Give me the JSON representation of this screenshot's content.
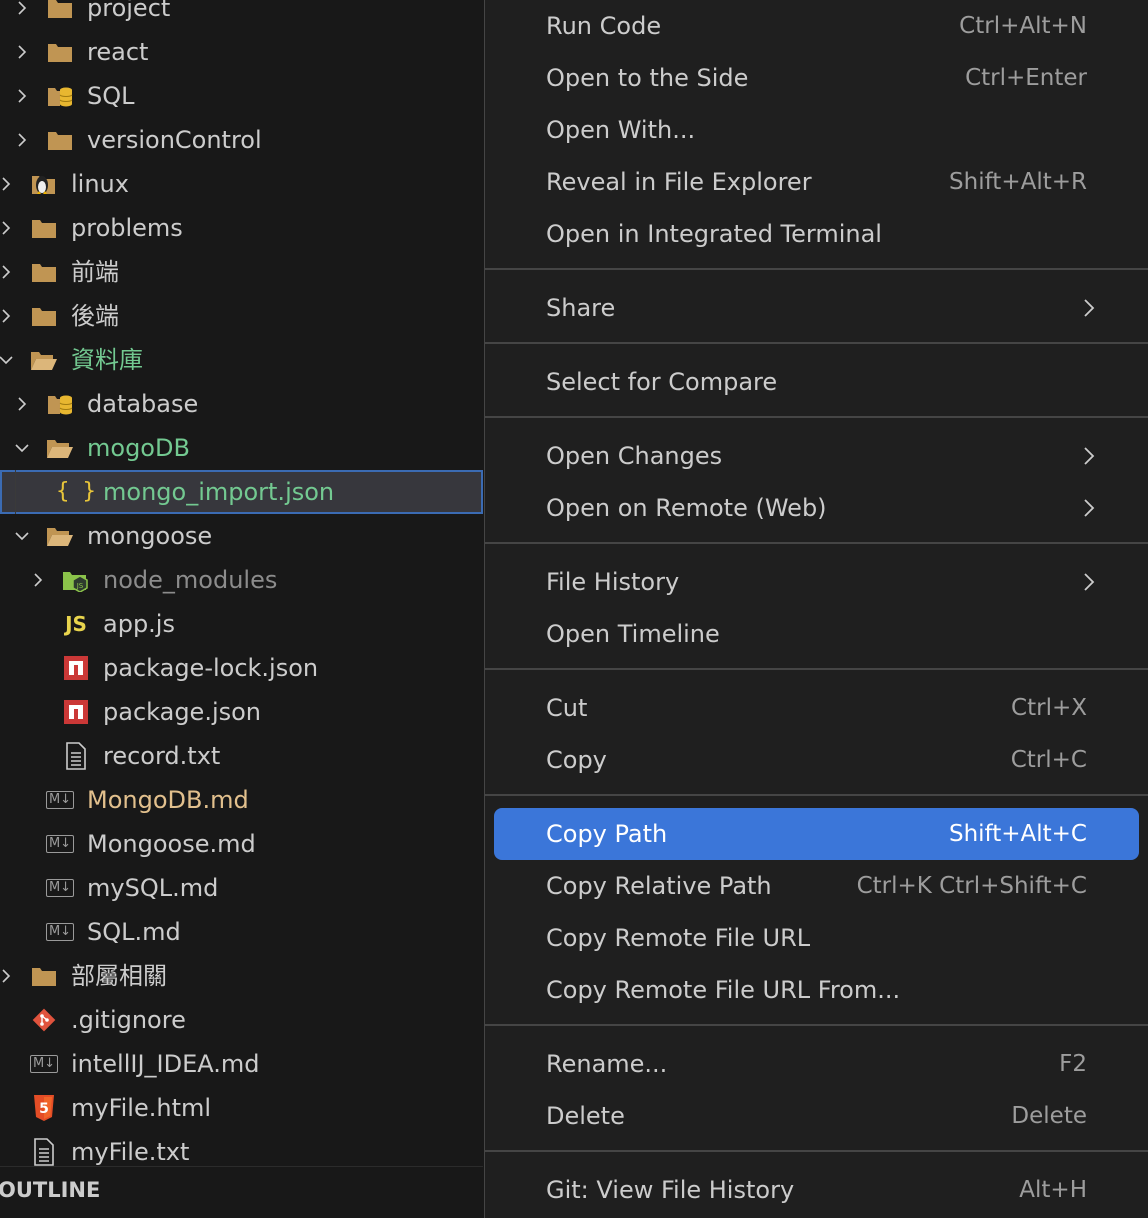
{
  "explorer": {
    "items": [
      {
        "label": "project"
      },
      {
        "label": "react"
      },
      {
        "label": "SQL"
      },
      {
        "label": "versionControl"
      },
      {
        "label": "linux"
      },
      {
        "label": "problems"
      },
      {
        "label": "前端"
      },
      {
        "label": "後端"
      },
      {
        "label": "資料庫"
      },
      {
        "label": "database"
      },
      {
        "label": "mogoDB"
      },
      {
        "label": "mongo_import.json"
      },
      {
        "label": "mongoose"
      },
      {
        "label": "node_modules"
      },
      {
        "label": "app.js"
      },
      {
        "label": "package-lock.json"
      },
      {
        "label": "package.json"
      },
      {
        "label": "record.txt"
      },
      {
        "label": "MongoDB.md"
      },
      {
        "label": "Mongoose.md"
      },
      {
        "label": "mySQL.md"
      },
      {
        "label": "SQL.md"
      },
      {
        "label": "部屬相關"
      },
      {
        "label": ".gitignore"
      },
      {
        "label": "intellIJ_IDEA.md"
      },
      {
        "label": "myFile.html"
      },
      {
        "label": "myFile.txt"
      }
    ],
    "outline_title": "OUTLINE",
    "icon_text": {
      "json": "{ }",
      "js": "JS",
      "md": "M↓",
      "html": "5",
      "npm": "n"
    },
    "colors": {
      "modified": "#e2c08d",
      "untracked": "#73c991",
      "selection_outline": "#3b6bb3"
    }
  },
  "menu": {
    "items": [
      {
        "label": "Run Code",
        "shortcut": "Ctrl+Alt+N"
      },
      {
        "label": "Open to the Side",
        "shortcut": "Ctrl+Enter"
      },
      {
        "label": "Open With...",
        "shortcut": ""
      },
      {
        "label": "Reveal in File Explorer",
        "shortcut": "Shift+Alt+R"
      },
      {
        "label": "Open in Integrated Terminal",
        "shortcut": ""
      },
      {
        "label": "Share",
        "shortcut": ""
      },
      {
        "label": "Select for Compare",
        "shortcut": ""
      },
      {
        "label": "Open Changes",
        "shortcut": ""
      },
      {
        "label": "Open on Remote (Web)",
        "shortcut": ""
      },
      {
        "label": "File History",
        "shortcut": ""
      },
      {
        "label": "Open Timeline",
        "shortcut": ""
      },
      {
        "label": "Cut",
        "shortcut": "Ctrl+X"
      },
      {
        "label": "Copy",
        "shortcut": "Ctrl+C"
      },
      {
        "label": "Copy Path",
        "shortcut": "Shift+Alt+C"
      },
      {
        "label": "Copy Relative Path",
        "shortcut": "Ctrl+K Ctrl+Shift+C"
      },
      {
        "label": "Copy Remote File URL",
        "shortcut": ""
      },
      {
        "label": "Copy Remote File URL From...",
        "shortcut": ""
      },
      {
        "label": "Rename...",
        "shortcut": "F2"
      },
      {
        "label": "Delete",
        "shortcut": "Delete"
      },
      {
        "label": "Git: View File History",
        "shortcut": "Alt+H"
      }
    ],
    "highlight_color": "#3b76d9"
  }
}
